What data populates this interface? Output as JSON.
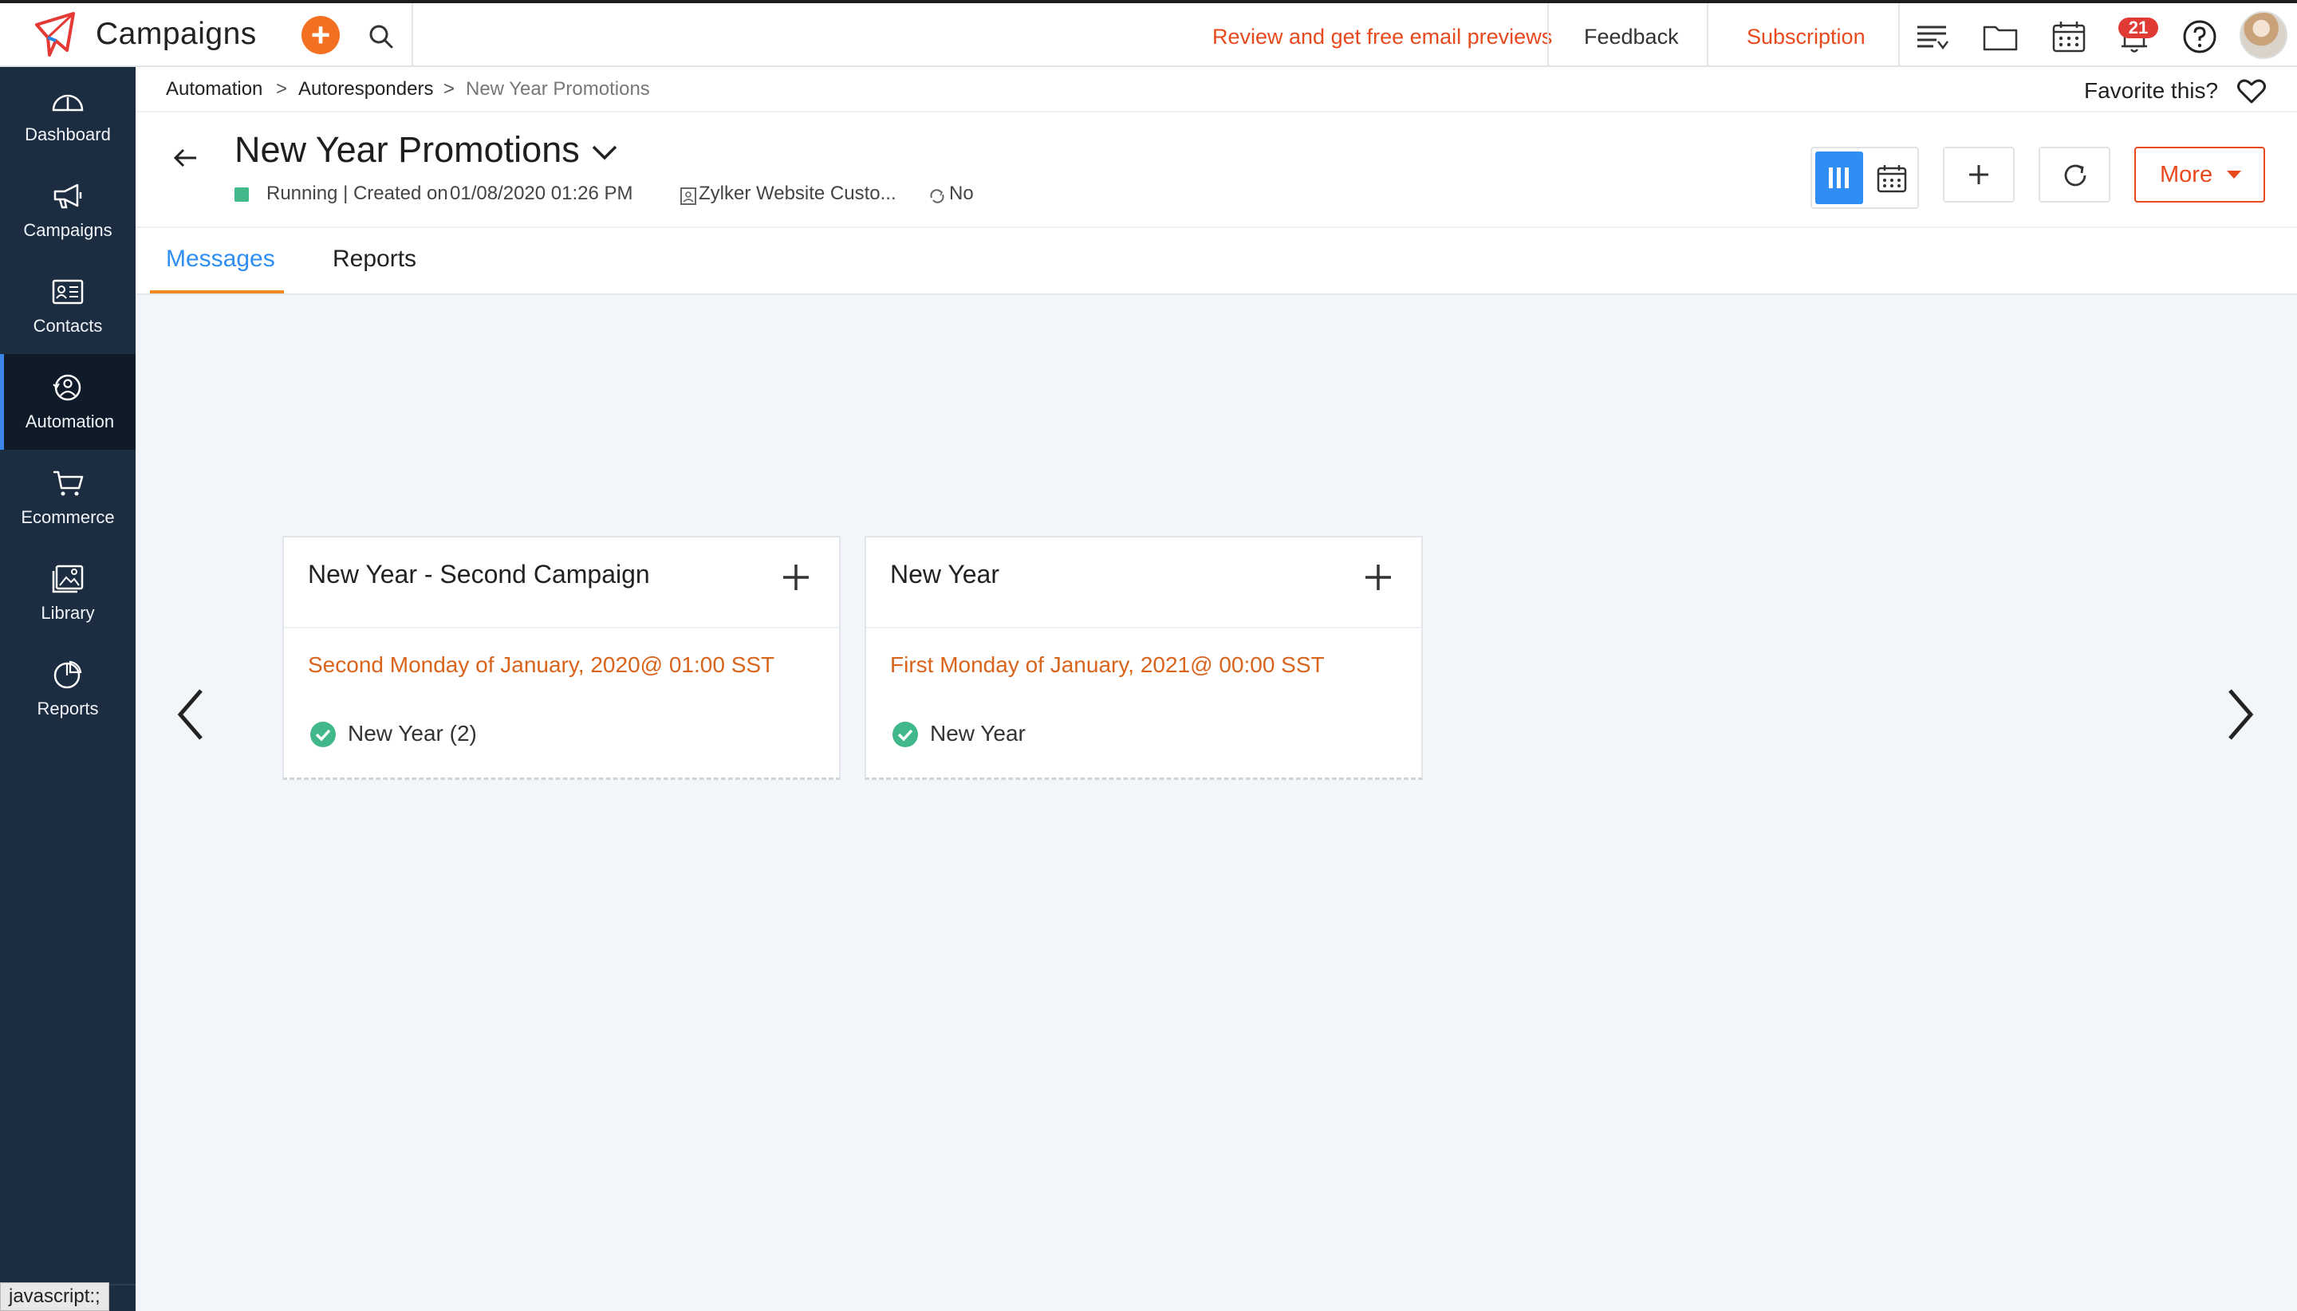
{
  "app": {
    "name": "Campaigns"
  },
  "topbar": {
    "promo_link": "Review and get free email previews",
    "feedback": "Feedback",
    "subscription": "Subscription",
    "notification_count": "21"
  },
  "sidebar": {
    "items": [
      {
        "label": "Dashboard",
        "icon": "dashboard-icon"
      },
      {
        "label": "Campaigns",
        "icon": "megaphone-icon"
      },
      {
        "label": "Contacts",
        "icon": "contact-card-icon"
      },
      {
        "label": "Automation",
        "icon": "automation-icon",
        "active": true
      },
      {
        "label": "Ecommerce",
        "icon": "cart-icon"
      },
      {
        "label": "Library",
        "icon": "image-library-icon"
      },
      {
        "label": "Reports",
        "icon": "pie-chart-icon"
      }
    ],
    "status_url": "javascript:;"
  },
  "breadcrumb": {
    "items": [
      "Automation",
      "Autoresponders",
      "New Year Promotions"
    ],
    "separator": ">"
  },
  "favorite": {
    "label": "Favorite this?"
  },
  "page": {
    "title": "New Year Promotions",
    "status": "Running | Created on",
    "created": "01/08/2020 01:26 PM",
    "list": "Zylker Website Custo...",
    "recurring": "No",
    "status_color": "#41b889"
  },
  "toolbar": {
    "more_label": "More"
  },
  "tabs": [
    {
      "label": "Messages",
      "active": true
    },
    {
      "label": "Reports",
      "active": false
    }
  ],
  "cards": [
    {
      "title": "New Year - Second Campaign",
      "schedule": "Second Monday of January, 2020@ 01:00 SST",
      "item": "New Year (2)"
    },
    {
      "title": "New Year",
      "schedule": "First Monday of January, 2021@ 00:00 SST",
      "item": "New Year"
    }
  ],
  "colors": {
    "accent_blue": "#2f8ef4",
    "brand_orange": "#e8491d",
    "sidebar_bg": "#1c2d41",
    "schedule_orange": "#d9641c"
  }
}
